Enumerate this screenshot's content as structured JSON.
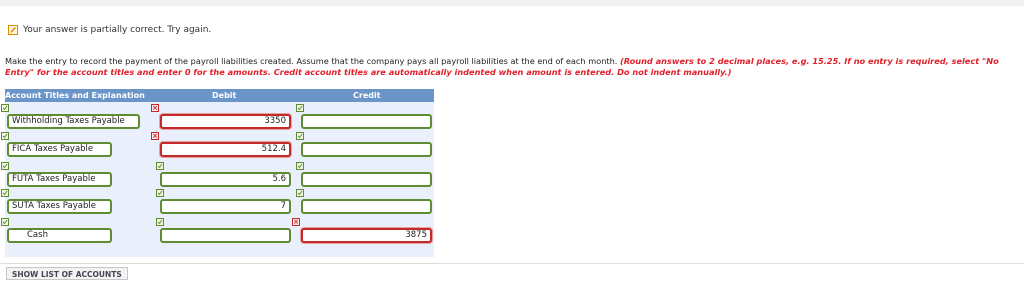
{
  "status": {
    "icon": "pencil-check-icon",
    "text": "Your answer is partially correct.  Try again."
  },
  "instructions": {
    "main": "Make the entry to record the payment of the payroll liabilities created. Assume that the company pays all payroll liabilities at the end of each month.",
    "note": "(Round answers to 2 decimal places, e.g. 15.25. If no entry is required, select \"No Entry\" for the account titles and enter 0 for the amounts. Credit account titles are automatically indented when amount is entered. Do not indent manually.)"
  },
  "table": {
    "headers": {
      "account": "Account Titles and Explanation",
      "debit": "Debit",
      "credit": "Credit"
    },
    "rows": [
      {
        "account": "Withholding Taxes Payable",
        "account_status": "correct",
        "debit": "3350",
        "debit_status": "incorrect",
        "credit": "",
        "credit_status": "correct"
      },
      {
        "account": "FICA Taxes Payable",
        "account_status": "correct",
        "debit": "512.4",
        "debit_status": "incorrect",
        "credit": "",
        "credit_status": "correct"
      },
      {
        "account": "FUTA Taxes Payable",
        "account_status": "correct",
        "debit": "5.6",
        "debit_status": "correct",
        "credit": "",
        "credit_status": "correct"
      },
      {
        "account": "SUTA Taxes Payable",
        "account_status": "correct",
        "debit": "7",
        "debit_status": "correct",
        "credit": "",
        "credit_status": "correct"
      },
      {
        "account": "Cash",
        "account_status": "correct",
        "debit": "",
        "debit_status": "correct",
        "credit": "3875",
        "credit_status": "incorrect"
      }
    ]
  },
  "buttons": {
    "show_accounts": "SHOW LIST OF ACCOUNTS"
  },
  "colors": {
    "header_bg": "#6b95c9",
    "body_bg": "#eaf0fb",
    "correct": "#5f8b33",
    "incorrect": "#c32a2a",
    "note_red": "#e0202a"
  }
}
